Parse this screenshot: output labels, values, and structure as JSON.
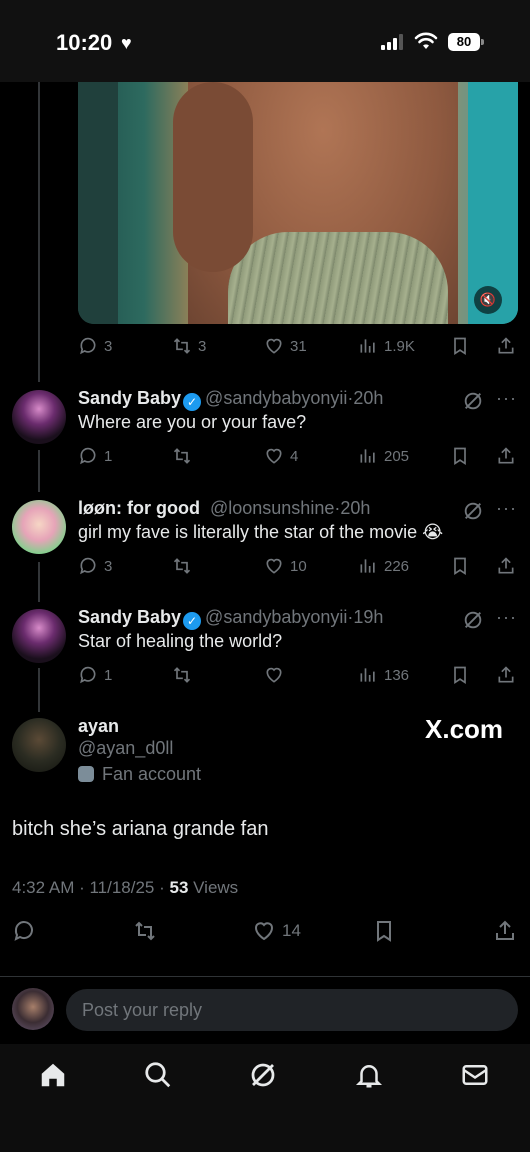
{
  "status_bar": {
    "time": "10:20",
    "battery": "80"
  },
  "media": {
    "actions": {
      "replies": "3",
      "reposts": "3",
      "likes": "31",
      "views": "1.9K"
    }
  },
  "replies": [
    {
      "name": "Sandy Baby",
      "verified": true,
      "handle": "@sandybabyonyii",
      "time": "20h",
      "text": "Where are you or your fave?",
      "replies": "1",
      "reposts": "",
      "likes": "4",
      "views": "205"
    },
    {
      "name": "løøn: for good",
      "verified": false,
      "handle": "@loonsunshine",
      "time": "20h",
      "text": "girl my fave is literally the star of the movie 😭",
      "replies": "3",
      "reposts": "",
      "likes": "10",
      "views": "226"
    },
    {
      "name": "Sandy Baby",
      "verified": true,
      "handle": "@sandybabyonyii",
      "time": "19h",
      "text": "Star of healing the world?",
      "replies": "1",
      "reposts": "",
      "likes": "",
      "views": "136"
    }
  ],
  "main_tweet": {
    "name": "ayan",
    "handle": "@ayan_d0ll",
    "badge": "Fan account",
    "watermark": "X.com",
    "text": "bitch she’s ariana grande fan",
    "time": "4:32 AM · 11/18/25 · ",
    "views_count": "53",
    "views_label": " Views",
    "likes": "14"
  },
  "reply_bar": {
    "placeholder": "Post your reply"
  },
  "colors": {
    "background": "#000000",
    "muted": "#71767b",
    "text": "#e7e9ea",
    "verified": "#1d9bf0"
  }
}
